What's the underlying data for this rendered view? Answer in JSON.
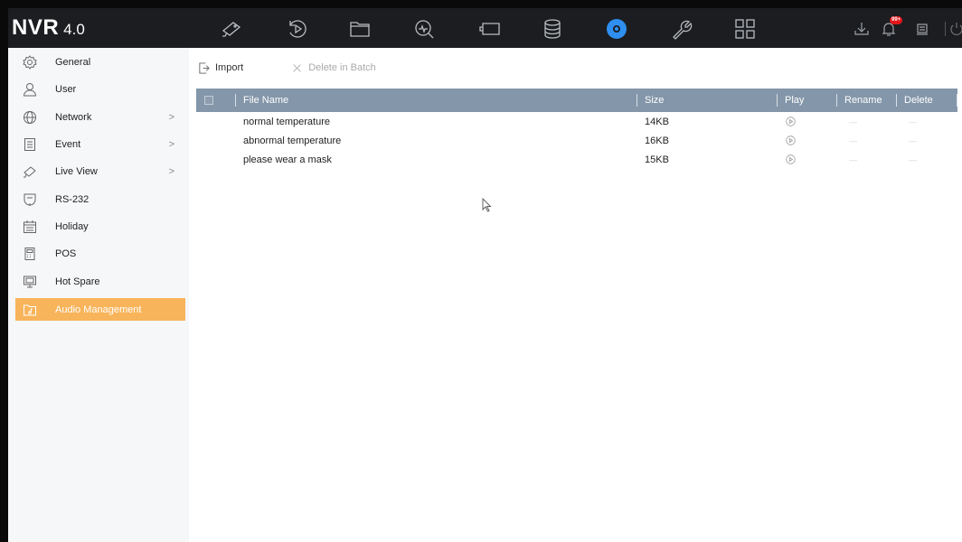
{
  "app": {
    "logo_main": "NVR",
    "logo_version": "4.0"
  },
  "topnav": {
    "items": [
      {
        "name": "live-view",
        "icon": "camera-icon"
      },
      {
        "name": "playback",
        "icon": "playback-icon"
      },
      {
        "name": "files",
        "icon": "folder-icon"
      },
      {
        "name": "smart-analysis",
        "icon": "search-analysis-icon"
      },
      {
        "name": "camera-mgmt",
        "icon": "camera-box-icon"
      },
      {
        "name": "storage",
        "icon": "database-icon"
      },
      {
        "name": "configuration",
        "icon": "gear-icon",
        "active": true
      },
      {
        "name": "maintenance",
        "icon": "wrench-icon"
      },
      {
        "name": "menu",
        "icon": "grid-icon"
      }
    ],
    "right": {
      "download_icon": "download-icon",
      "alarm_icon": "bell-icon",
      "alarm_badge": "99+",
      "lock_icon": "lock-icon",
      "power_icon": "power-icon"
    },
    "accent_color": "#2f8ff0"
  },
  "sidebar": {
    "items": [
      {
        "label": "General",
        "icon": "general-settings-icon",
        "chevron": false
      },
      {
        "label": "User",
        "icon": "user-icon",
        "chevron": false
      },
      {
        "label": "Network",
        "icon": "globe-icon",
        "chevron": true
      },
      {
        "label": "Event",
        "icon": "event-icon",
        "chevron": true
      },
      {
        "label": "Live View",
        "icon": "camera-icon",
        "chevron": true
      },
      {
        "label": "RS-232",
        "icon": "rs232-icon",
        "chevron": false
      },
      {
        "label": "Holiday",
        "icon": "calendar-icon",
        "chevron": false
      },
      {
        "label": "POS",
        "icon": "pos-icon",
        "chevron": false
      },
      {
        "label": "Hot Spare",
        "icon": "hot-spare-icon",
        "chevron": false
      },
      {
        "label": "Audio Management",
        "icon": "audio-file-icon",
        "chevron": false,
        "active": true
      }
    ],
    "chevron_glyph": ">",
    "active_color": "#f8b45a"
  },
  "toolbar": {
    "import_label": "Import",
    "delete_batch_label": "Delete in Batch"
  },
  "table": {
    "columns": {
      "file_name": "File Name",
      "size": "Size",
      "play": "Play",
      "rename": "Rename",
      "delete": "Delete"
    },
    "header_color": "#8496a9",
    "rows": [
      {
        "file_name": "normal temperature",
        "size": "14KB",
        "rename": "—",
        "delete": "—"
      },
      {
        "file_name": "abnormal temperature",
        "size": "16KB",
        "rename": "—",
        "delete": "—"
      },
      {
        "file_name": "please wear a mask",
        "size": "15KB",
        "rename": "—",
        "delete": "—"
      }
    ]
  }
}
